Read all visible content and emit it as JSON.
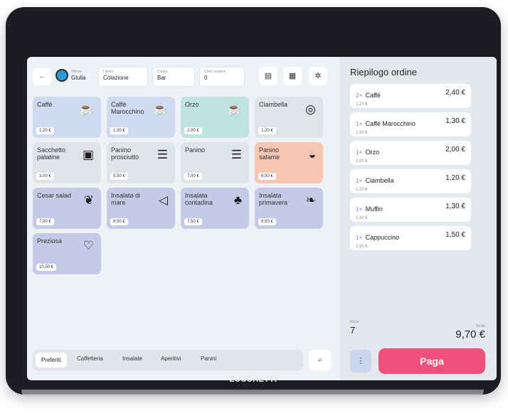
{
  "brand": "ZUCCHETTI",
  "header": {
    "user_label": "Utente",
    "user_value": "Giulia",
    "list_label": "Listino",
    "list_value": "Colazione",
    "register_label": "Cassa",
    "register_value": "Bar",
    "suspended_label": "Conti sospesi",
    "suspended_value": "0"
  },
  "products": [
    {
      "name": "Caffé",
      "price": "1,20 €",
      "icon": "☕"
    },
    {
      "name": "Caffé Marocchino",
      "price": "1,30 €",
      "icon": "☕"
    },
    {
      "name": "Orzo",
      "price": "2,00 €",
      "icon": "☕"
    },
    {
      "name": "Ciambella",
      "price": "1,20 €",
      "icon": "◎"
    },
    {
      "name": "Sacchetto patatine",
      "price": "3,00 €",
      "icon": "▣"
    },
    {
      "name": "Panino prosciutto",
      "price": "5,50 €",
      "icon": "☰"
    },
    {
      "name": "Panino",
      "price": "7,00 €",
      "icon": "☰"
    },
    {
      "name": "Panino salame",
      "price": "6,50 €",
      "icon": "◒"
    },
    {
      "name": "Cesar salad",
      "price": "7,00 €",
      "icon": "❦"
    },
    {
      "name": "Insalata di mare",
      "price": "8,50 €",
      "icon": "◁"
    },
    {
      "name": "Insalata contadina",
      "price": "7,50 €",
      "icon": "♣"
    },
    {
      "name": "Insalata primavera",
      "price": "9,50 €",
      "icon": "❧"
    },
    {
      "name": "Preziosa",
      "price": "10,50 €",
      "icon": "♡"
    }
  ],
  "tabs": [
    "Preferiti",
    "Caffetteria",
    "Insalate",
    "Aperitivi",
    "Panini"
  ],
  "summary": {
    "title": "Riepilogo ordine",
    "items": [
      {
        "qty": "2×",
        "name": "Caffé",
        "unit": "1,20 €",
        "total": "2,40 €"
      },
      {
        "qty": "1×",
        "name": "Caffé Marocchino",
        "unit": "1,30 €",
        "total": "1,30 €"
      },
      {
        "qty": "1×",
        "name": "Orzo",
        "unit": "2,00 €",
        "total": "2,00 €"
      },
      {
        "qty": "1×",
        "name": "Ciambella",
        "unit": "1,20 €",
        "total": "1,20 €"
      },
      {
        "qty": "1×",
        "name": "Muffin",
        "unit": "1,30 €",
        "total": "1,30 €"
      },
      {
        "qty": "1×",
        "name": "Cappuccino",
        "unit": "1,50 €",
        "total": "1,50 €"
      }
    ],
    "pieces_label": "Pezzi",
    "pieces_value": "7",
    "total_label": "Totale",
    "total_value": "9,70 €",
    "more_label": "⋮",
    "pay_label": "Paga"
  }
}
